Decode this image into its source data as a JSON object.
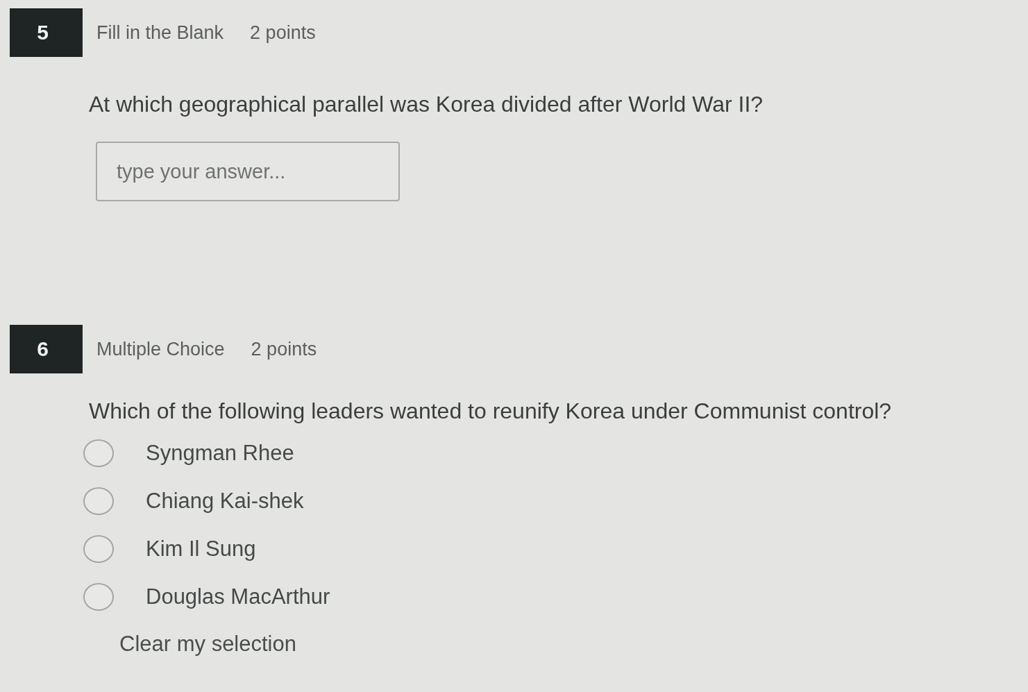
{
  "questions": [
    {
      "number": "5",
      "kind": "fill_blank",
      "type_label": "Fill in the Blank",
      "points": "2 points",
      "prompt": "At which geographical parallel was Korea divided after World War II?",
      "answer": {
        "placeholder": "type your answer..."
      }
    },
    {
      "number": "6",
      "kind": "multiple_choice",
      "type_label": "Multiple Choice",
      "points": "2 points",
      "prompt": "Which of the following leaders wanted to reunify Korea under Communist control?",
      "options": [
        {
          "label": "Syngman Rhee",
          "selected": false
        },
        {
          "label": "Chiang Kai-shek",
          "selected": false
        },
        {
          "label": "Kim Il Sung",
          "selected": false
        },
        {
          "label": "Douglas MacArthur",
          "selected": false
        }
      ],
      "clear_label": "Clear my selection"
    }
  ]
}
